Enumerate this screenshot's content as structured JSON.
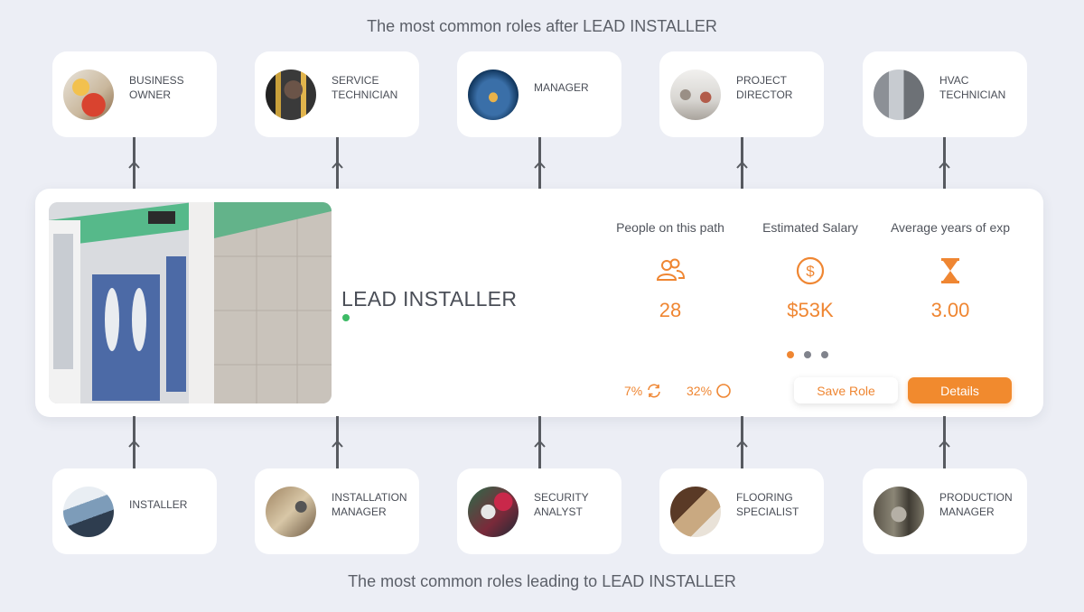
{
  "headings": {
    "top": "The most common roles after LEAD INSTALLER",
    "bottom": "The most common roles leading to LEAD INSTALLER"
  },
  "roles_after": [
    {
      "line1": "BUSINESS",
      "line2": "OWNER"
    },
    {
      "line1": "SERVICE",
      "line2": "TECHNICIAN"
    },
    {
      "line1": "MANAGER",
      "line2": ""
    },
    {
      "line1": "PROJECT",
      "line2": "DIRECTOR"
    },
    {
      "line1": "HVAC",
      "line2": "TECHNICIAN"
    }
  ],
  "roles_before": [
    {
      "line1": "INSTALLER",
      "line2": ""
    },
    {
      "line1": "INSTALLATION",
      "line2": "MANAGER"
    },
    {
      "line1": "SECURITY",
      "line2": "ANALYST"
    },
    {
      "line1": "FLOORING",
      "line2": "SPECIALIST"
    },
    {
      "line1": "PRODUCTION",
      "line2": "MANAGER"
    }
  ],
  "current_role": {
    "title": "LEAD INSTALLER",
    "stats": [
      {
        "label": "People on this path",
        "value": "28",
        "icon": "people-icon"
      },
      {
        "label": "Estimated Salary",
        "value": "$53K",
        "icon": "dollar-icon"
      },
      {
        "label": "Average years of exp",
        "value": "3.00",
        "icon": "hourglass-icon"
      }
    ],
    "carousel": {
      "count": 3,
      "active": 0
    },
    "metrics": [
      {
        "value": "7%",
        "icon": "refresh-icon"
      },
      {
        "value": "32%",
        "icon": "circle-icon"
      }
    ],
    "buttons": {
      "save": "Save Role",
      "details": "Details"
    }
  },
  "colors": {
    "accent": "#ef8632",
    "status_green": "#3dbb66",
    "background": "#eceef5"
  }
}
